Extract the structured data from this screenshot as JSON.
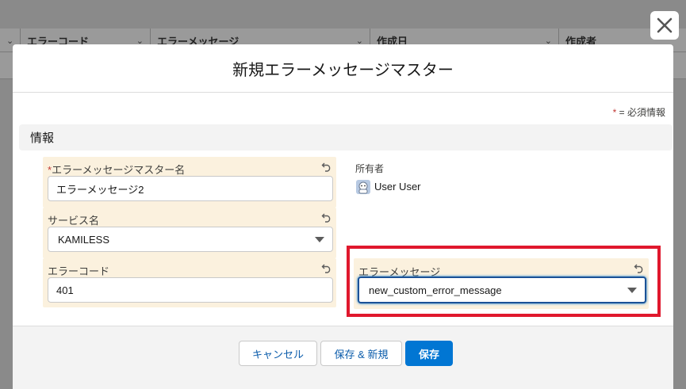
{
  "background": {
    "columns": [
      {
        "label": ""
      },
      {
        "label": "エラーコード"
      },
      {
        "label": "エラーメッセージ"
      },
      {
        "label": "作成日"
      },
      {
        "label": "作成者"
      }
    ]
  },
  "modal": {
    "title": "新規エラーメッセージマスター",
    "required_legend": "= 必須情報",
    "required_star": "*",
    "section_title": "情報",
    "fields": {
      "name": {
        "label": "エラーメッセージマスター名",
        "value": "エラーメッセージ2",
        "required_star": "*"
      },
      "service": {
        "label": "サービス名",
        "value": "KAMILESS"
      },
      "error_code": {
        "label": "エラーコード",
        "value": "401"
      },
      "error_message": {
        "label": "エラーメッセージ",
        "value": "new_custom_error_message"
      }
    },
    "owner": {
      "label": "所有者",
      "name": "User User"
    },
    "buttons": {
      "cancel": "キャンセル",
      "save_new": "保存 & 新規",
      "save": "保存"
    }
  },
  "colors": {
    "brand": "#0176d3",
    "highlight": "#e0182d",
    "edited_field_bg": "#fbf1de"
  }
}
